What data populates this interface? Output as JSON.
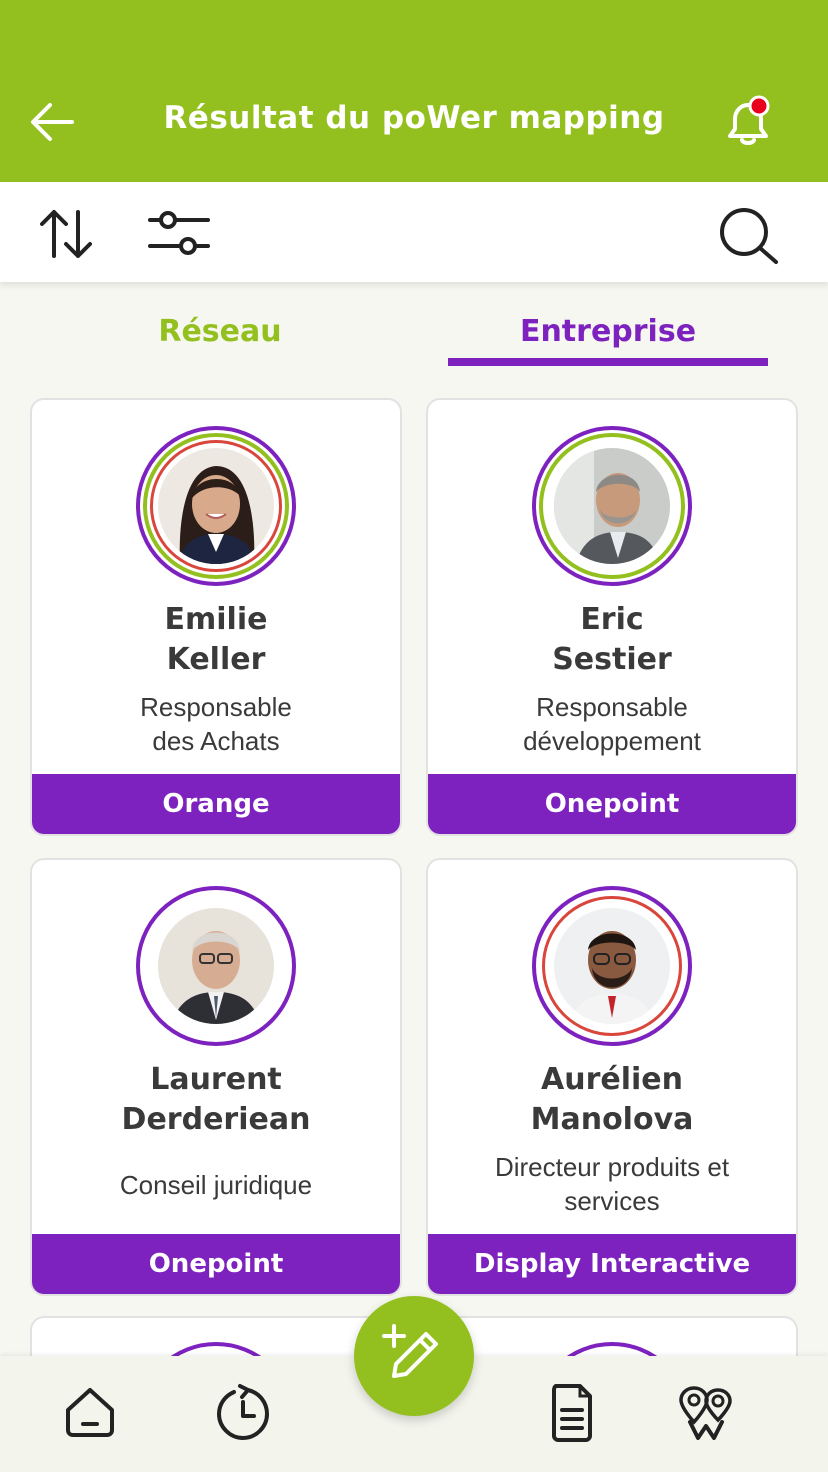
{
  "header": {
    "title": "Résultat du poWer mapping",
    "back_icon": "arrow-left-icon",
    "notification_icon": "bell-icon",
    "has_notification": true
  },
  "toolbar": {
    "sort_icon": "sort-arrows-icon",
    "filter_icon": "sliders-icon",
    "search_icon": "search-icon"
  },
  "tabs": [
    {
      "label": "Réseau",
      "active": false
    },
    {
      "label": "Entreprise",
      "active": true
    }
  ],
  "contacts": [
    {
      "first_name": "Emilie",
      "last_name": "Keller",
      "role_line1": "Responsable",
      "role_line2": "des Achats",
      "company": "Orange"
    },
    {
      "first_name": "Eric",
      "last_name": "Sestier",
      "role_line1": "Responsable",
      "role_line2": "développement",
      "company": "Onepoint"
    },
    {
      "first_name": "Laurent",
      "last_name": "Derderiean",
      "role_line1": "Conseil juridique",
      "role_line2": "",
      "company": "Onepoint"
    },
    {
      "first_name": "Aurélien",
      "last_name": "Manolova",
      "role_line1": "Directeur produits et",
      "role_line2": "services",
      "company": "Display Interactive"
    }
  ],
  "bottom_nav": {
    "items": [
      "home-icon",
      "history-icon",
      "document-icon",
      "map-pins-icon"
    ],
    "fab_icon": "add-edit-icon"
  },
  "colors": {
    "brand_green": "#93c01f",
    "brand_purple": "#7d22bf",
    "ring_red": "#d9463c",
    "notification_dot": "#e8001c"
  }
}
